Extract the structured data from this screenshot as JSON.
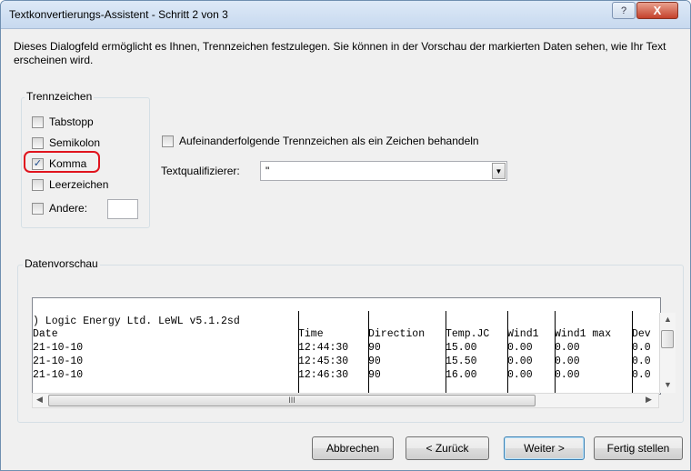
{
  "window": {
    "title": "Textkonvertierungs-Assistent - Schritt 2 von 3",
    "help_glyph": "?",
    "close_glyph": "X"
  },
  "description": "Dieses Dialogfeld ermöglicht es Ihnen, Trennzeichen festzulegen. Sie können in der Vorschau der markierten Daten sehen, wie Ihr Text erscheinen wird.",
  "delimiters": {
    "group_label": "Trennzeichen",
    "items": [
      {
        "label": "Tabstopp",
        "checked": false
      },
      {
        "label": "Semikolon",
        "checked": false
      },
      {
        "label": "Komma",
        "checked": true
      },
      {
        "label": "Leerzeichen",
        "checked": false
      },
      {
        "label": "Andere:",
        "checked": false
      }
    ],
    "other_value": ""
  },
  "consecutive": {
    "label": "Aufeinanderfolgende Trennzeichen als ein Zeichen behandeln",
    "checked": false
  },
  "text_qualifier": {
    "label": "Textqualifizierer:",
    "value": "\""
  },
  "preview": {
    "group_label": "Datenvorschau",
    "rows": [
      [
        ") Logic Energy Ltd. LeWL v5.1.2sd",
        "",
        "",
        "",
        "",
        "",
        ""
      ],
      [
        "Date",
        "Time",
        "Direction",
        "Temp.ЈC",
        "Wind1",
        "Wind1 max",
        "Dev"
      ],
      [
        "21-10-10",
        "12:44:30",
        "90",
        "15.00",
        "0.00",
        "0.00",
        "0.0"
      ],
      [
        "21-10-10",
        "12:45:30",
        "90",
        "15.50",
        "0.00",
        "0.00",
        "0.0"
      ],
      [
        "21-10-10",
        "12:46:30",
        "90",
        "16.00",
        "0.00",
        "0.00",
        "0.0"
      ]
    ],
    "hscroll_grip": "III"
  },
  "buttons": {
    "cancel": "Abbrechen",
    "back": "< Zurück",
    "next": "Weiter >",
    "finish": "Fertig stellen"
  },
  "accent_colors": {
    "highlight": "#e0141e",
    "default_button_border": "#3c7fb1"
  }
}
